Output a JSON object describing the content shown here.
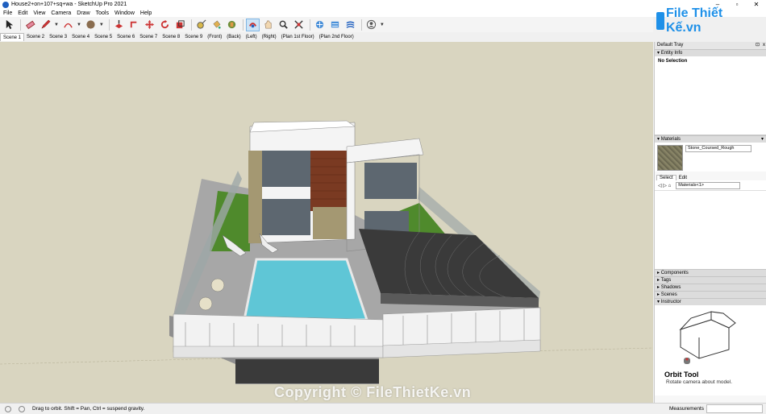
{
  "window": {
    "title": "House2+on+107+sq+wa - SketchUp Pro 2021",
    "controls": [
      "–",
      "▫",
      "✕"
    ]
  },
  "menu": [
    "File",
    "Edit",
    "View",
    "Camera",
    "Draw",
    "Tools",
    "Window",
    "Help"
  ],
  "toolbar": {
    "tools": [
      "select-icon",
      "eraser-icon",
      "pencil-icon",
      "arc-icon",
      "rectangle-icon",
      "push-pull-icon",
      "follow-me-icon",
      "move-icon",
      "rotate-icon",
      "scale-icon",
      "tape-measure-icon",
      "paint-bucket-icon",
      "text-icon",
      "orbit-icon",
      "pan-icon",
      "zoom-icon",
      "zoom-extents-icon",
      "warehouse-icon",
      "extension-icon",
      "layers-icon",
      "account-icon"
    ],
    "active_tool": "orbit-icon"
  },
  "scenes": [
    "Scene 1",
    "Scene 2",
    "Scene 3",
    "Scene 4",
    "Scene 5",
    "Scene 6",
    "Scene 7",
    "Scene 8",
    "Scene 9",
    "(Front)",
    "(Back)",
    "(Left)",
    "(Right)",
    "(Plan 1st Floor)",
    "(Plan 2nd Floor)"
  ],
  "active_scene": "Scene 1",
  "logo": {
    "text": "File Thiết Kế.vn",
    "color": "#1e90e8"
  },
  "watermark": "Copyright © FileThietKe.vn",
  "tray": {
    "title": "Default Tray",
    "close": "x",
    "pin": "⊡",
    "entity_info": {
      "header": "Entity Info",
      "selection": "No Selection"
    },
    "materials": {
      "header": "Materials",
      "material_name": "Stone_Coursed_Rough",
      "tabs": [
        "Select",
        "Edit"
      ],
      "library": "Materials<1>"
    },
    "collapsed_panels": [
      "Components",
      "Tags",
      "Shadows",
      "Scenes"
    ],
    "instructor": {
      "header": "Instructor",
      "tool_title": "Orbit Tool",
      "tool_desc": "Rotate camera about model."
    }
  },
  "status": {
    "message": "Drag to orbit. Shift = Pan, Ctrl = suspend gravity.",
    "measurements_label": "Measurements",
    "measurements_value": ""
  },
  "colors": {
    "viewport_bg": "#d9d5c0",
    "pool": "#5fc6d6",
    "grass": "#4f8a2c",
    "wall_white": "#f4f4f4",
    "accent_brown": "#7a3a22",
    "canopy": "#3a3a3a"
  }
}
